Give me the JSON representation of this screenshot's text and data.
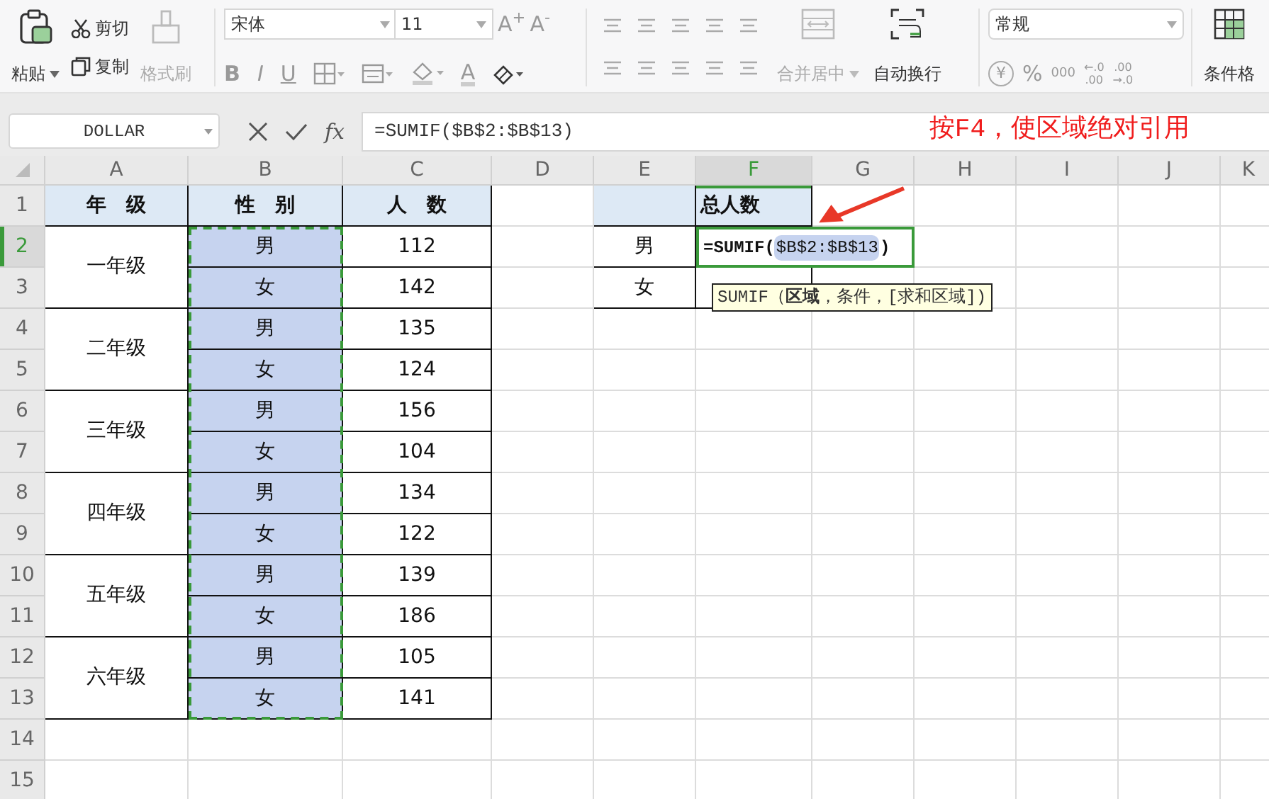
{
  "toolbar": {
    "clipboard": {
      "paste": {
        "label": "粘贴"
      },
      "cut": {
        "label": "剪切"
      },
      "copy": {
        "label": "复制"
      },
      "format_painter": {
        "label": "格式刷",
        "disabled": true
      }
    },
    "font": {
      "name": "宋体",
      "size": "11",
      "grow": "A$^{+}$",
      "shrink": "A$^{-}$",
      "styles": [
        "B",
        "I",
        "U"
      ],
      "color_letter": "A"
    },
    "alignment": {
      "merge": {
        "label": "合并居中",
        "disabled": true
      },
      "wrap": {
        "label": "自动换行",
        "disabled": false
      }
    },
    "number": {
      "format": "常规",
      "currency": "¥",
      "percent": "%",
      "thousands": "000",
      "decimals": [
        [
          "←.0",
          ".00"
        ],
        [
          ".00",
          "→.0"
        ]
      ]
    },
    "conditional_format": {
      "label": "条件格"
    }
  },
  "formula_bar": {
    "name_box": "DOLLAR",
    "fx": "fx",
    "formula": "=SUMIF($B$2:$B$13)"
  },
  "annotation": {
    "text": "按F4，使区域绝对引用"
  },
  "sheet": {
    "columns": [
      {
        "label": "A",
        "selected": false
      },
      {
        "label": "B",
        "selected": false
      },
      {
        "label": "C",
        "selected": false
      },
      {
        "label": "D",
        "selected": false
      },
      {
        "label": "E",
        "selected": false
      },
      {
        "label": "F",
        "selected": true
      },
      {
        "label": "G",
        "selected": false
      },
      {
        "label": "H",
        "selected": false
      },
      {
        "label": "I",
        "selected": false
      },
      {
        "label": "J",
        "selected": false
      },
      {
        "label": "K",
        "selected": false
      }
    ],
    "rows": [
      {
        "label": "1",
        "selected": false
      },
      {
        "label": "2",
        "selected": true
      },
      {
        "label": "3",
        "selected": false
      },
      {
        "label": "4",
        "selected": false
      },
      {
        "label": "5",
        "selected": false
      },
      {
        "label": "6",
        "selected": false
      },
      {
        "label": "7",
        "selected": false
      },
      {
        "label": "8",
        "selected": false
      },
      {
        "label": "9",
        "selected": false
      },
      {
        "label": "10",
        "selected": false
      },
      {
        "label": "11",
        "selected": false
      },
      {
        "label": "12",
        "selected": false
      },
      {
        "label": "13",
        "selected": false
      },
      {
        "label": "14",
        "selected": false
      },
      {
        "label": "15",
        "selected": false
      }
    ],
    "table": {
      "headers": [
        "年　级",
        "性　别",
        "人　数"
      ],
      "groups": [
        {
          "grade": "一年级",
          "rows": [
            {
              "gender": "男",
              "count": "112"
            },
            {
              "gender": "女",
              "count": "142"
            }
          ]
        },
        {
          "grade": "二年级",
          "rows": [
            {
              "gender": "男",
              "count": "135"
            },
            {
              "gender": "女",
              "count": "124"
            }
          ]
        },
        {
          "grade": "三年级",
          "rows": [
            {
              "gender": "男",
              "count": "156"
            },
            {
              "gender": "女",
              "count": "104"
            }
          ]
        },
        {
          "grade": "四年级",
          "rows": [
            {
              "gender": "男",
              "count": "134"
            },
            {
              "gender": "女",
              "count": "122"
            }
          ]
        },
        {
          "grade": "五年级",
          "rows": [
            {
              "gender": "男",
              "count": "139"
            },
            {
              "gender": "女",
              "count": "186"
            }
          ]
        },
        {
          "grade": "六年级",
          "rows": [
            {
              "gender": "男",
              "count": "105"
            },
            {
              "gender": "女",
              "count": "141"
            }
          ]
        }
      ]
    },
    "summary": {
      "header": "总人数",
      "rows": [
        {
          "label": "男",
          "editing": {
            "prefix": "=SUMIF(",
            "reference": "$B$2:$B$13",
            "suffix": ")"
          }
        },
        {
          "label": "女"
        }
      ]
    },
    "tooltip": "SUMIF（**区域**，条件，[求和区域])"
  }
}
